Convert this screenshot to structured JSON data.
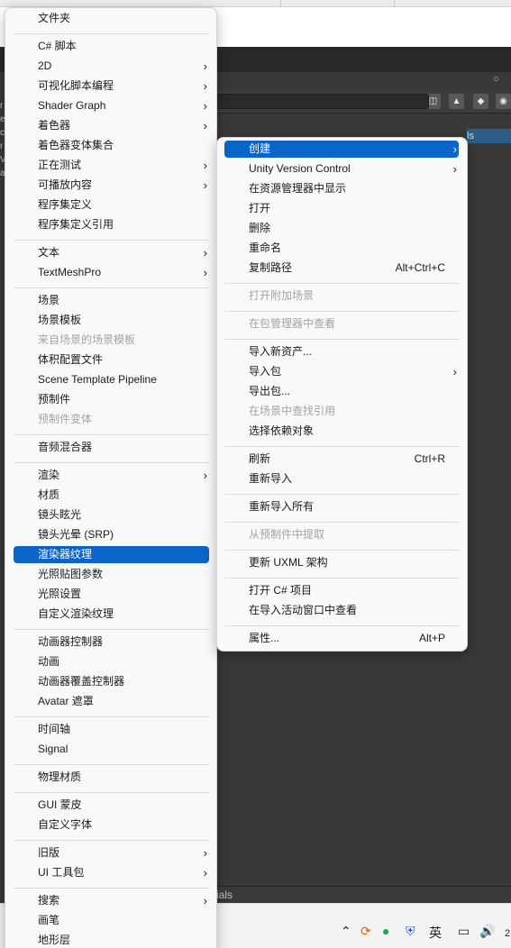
{
  "background": {
    "window_tail": "ials",
    "selected_row_text": "ls",
    "lock_icon": "lock-icon",
    "edge_text": [
      "r",
      "e",
      "c",
      "r",
      "V",
      "a"
    ],
    "taskbar": {
      "ime_label": "英",
      "clock_fragment": "2"
    }
  },
  "left_menu": {
    "groups": [
      [
        {
          "label": "文件夹"
        }
      ],
      [
        {
          "label": "C# 脚本"
        },
        {
          "label": "2D",
          "submenu": true
        },
        {
          "label": "可视化脚本编程",
          "submenu": true
        },
        {
          "label": "Shader Graph",
          "submenu": true
        },
        {
          "label": "着色器",
          "submenu": true
        },
        {
          "label": "着色器变体集合"
        },
        {
          "label": "正在测试",
          "submenu": true
        },
        {
          "label": "可播放内容",
          "submenu": true
        },
        {
          "label": "程序集定义"
        },
        {
          "label": "程序集定义引用"
        }
      ],
      [
        {
          "label": "文本",
          "submenu": true
        },
        {
          "label": "TextMeshPro",
          "submenu": true
        }
      ],
      [
        {
          "label": "场景"
        },
        {
          "label": "场景模板"
        },
        {
          "label": "来自场景的场景模板",
          "disabled": true
        },
        {
          "label": "体积配置文件"
        },
        {
          "label": "Scene Template Pipeline"
        },
        {
          "label": "预制件"
        },
        {
          "label": "预制件变体",
          "disabled": true
        }
      ],
      [
        {
          "label": "音频混合器"
        }
      ],
      [
        {
          "label": "渲染",
          "submenu": true
        },
        {
          "label": "材质"
        },
        {
          "label": "镜头眩光"
        },
        {
          "label": "镜头光晕 (SRP)"
        },
        {
          "label": "渲染器纹理",
          "highlighted": true
        },
        {
          "label": "光照贴图参数"
        },
        {
          "label": "光照设置"
        },
        {
          "label": "自定义渲染纹理"
        }
      ],
      [
        {
          "label": "动画器控制器"
        },
        {
          "label": "动画"
        },
        {
          "label": "动画器覆盖控制器"
        },
        {
          "label": "Avatar 遮罩"
        }
      ],
      [
        {
          "label": "时间轴"
        },
        {
          "label": "Signal"
        }
      ],
      [
        {
          "label": "物理材质"
        }
      ],
      [
        {
          "label": "GUI 蒙皮"
        },
        {
          "label": "自定义字体"
        }
      ],
      [
        {
          "label": "旧版",
          "submenu": true
        },
        {
          "label": "UI 工具包",
          "submenu": true
        }
      ],
      [
        {
          "label": "搜索",
          "submenu": true
        },
        {
          "label": "画笔"
        },
        {
          "label": "地形层"
        }
      ]
    ]
  },
  "right_menu": {
    "groups": [
      [
        {
          "label": "创建",
          "submenu": true,
          "highlighted": true
        },
        {
          "label": "Unity Version Control",
          "submenu": true
        },
        {
          "label": "在资源管理器中显示"
        },
        {
          "label": "打开"
        },
        {
          "label": "删除"
        },
        {
          "label": "重命名"
        },
        {
          "label": "复制路径",
          "shortcut": "Alt+Ctrl+C"
        }
      ],
      [
        {
          "label": "打开附加场景",
          "disabled": true
        }
      ],
      [
        {
          "label": "在包管理器中查看",
          "disabled": true
        }
      ],
      [
        {
          "label": "导入新资产..."
        },
        {
          "label": "导入包",
          "submenu": true
        },
        {
          "label": "导出包..."
        },
        {
          "label": "在场景中查找引用",
          "disabled": true
        },
        {
          "label": "选择依赖对象"
        }
      ],
      [
        {
          "label": "刷新",
          "shortcut": "Ctrl+R"
        },
        {
          "label": "重新导入"
        }
      ],
      [
        {
          "label": "重新导入所有"
        }
      ],
      [
        {
          "label": "从预制件中提取",
          "disabled": true
        }
      ],
      [
        {
          "label": "更新 UXML 架构"
        }
      ],
      [
        {
          "label": "打开 C# 项目"
        },
        {
          "label": "在导入活动窗口中查看"
        }
      ],
      [
        {
          "label": "属性...",
          "shortcut": "Alt+P"
        }
      ]
    ]
  },
  "colors": {
    "highlight": "#0b64c8",
    "disabled_text": "#a3a3a3",
    "menu_bg": "#f9f9f9"
  }
}
